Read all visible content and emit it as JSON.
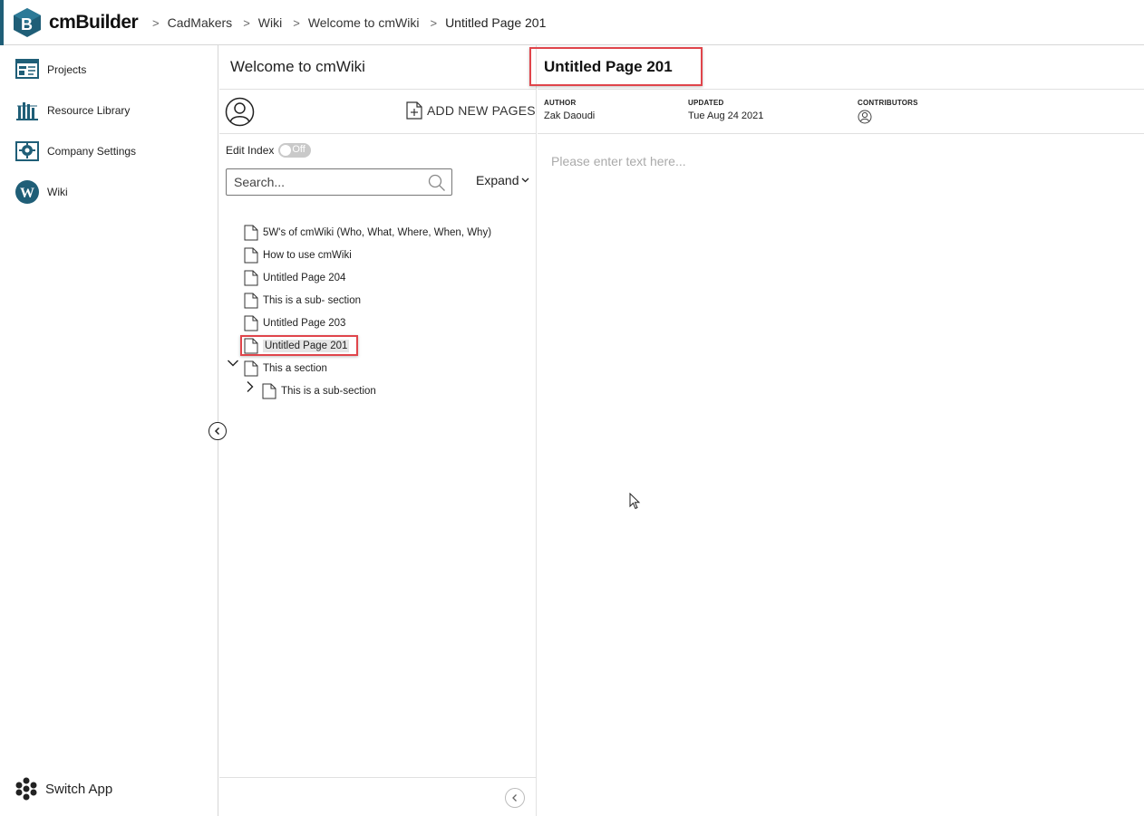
{
  "app": {
    "brand": "cmBuilder",
    "accent_color": "#1f5e77",
    "highlight_color": "#e0454b"
  },
  "breadcrumbs": [
    "CadMakers",
    "Wiki",
    "Welcome to cmWiki",
    "Untitled Page 201"
  ],
  "nav": {
    "items": [
      {
        "label": "Projects",
        "icon": "projects-icon"
      },
      {
        "label": "Resource Library",
        "icon": "resource-library-icon"
      },
      {
        "label": "Company Settings",
        "icon": "company-settings-icon"
      },
      {
        "label": "Wiki",
        "icon": "wiki-icon"
      }
    ],
    "switch_app": "Switch App"
  },
  "wiki": {
    "title": "Welcome to cmWiki",
    "add_pages": "ADD NEW PAGES",
    "edit_index_label": "Edit Index",
    "edit_index_state": "Off",
    "search_placeholder": "Search...",
    "expand_label": "Expand",
    "tree": [
      {
        "label": "5W's of cmWiki (Who, What, Where, When, Why)",
        "level": 0
      },
      {
        "label": "How to use cmWiki",
        "level": 0
      },
      {
        "label": "Untitled Page 204",
        "level": 0
      },
      {
        "label": "This is a sub- section",
        "level": 0
      },
      {
        "label": "Untitled Page 203",
        "level": 0
      },
      {
        "label": "Untitled Page 201",
        "level": 0,
        "selected": true
      },
      {
        "label": "This a section",
        "level": 0,
        "expanded": true
      },
      {
        "label": "This is a sub-section",
        "level": 1,
        "collapsed": true
      }
    ]
  },
  "page": {
    "title": "Untitled Page 201",
    "author_label": "AUTHOR",
    "author": "Zak Daoudi",
    "updated_label": "UPDATED",
    "updated": "Tue Aug 24 2021",
    "contributors_label": "CONTRIBUTORS",
    "editor_placeholder": "Please enter text here..."
  }
}
